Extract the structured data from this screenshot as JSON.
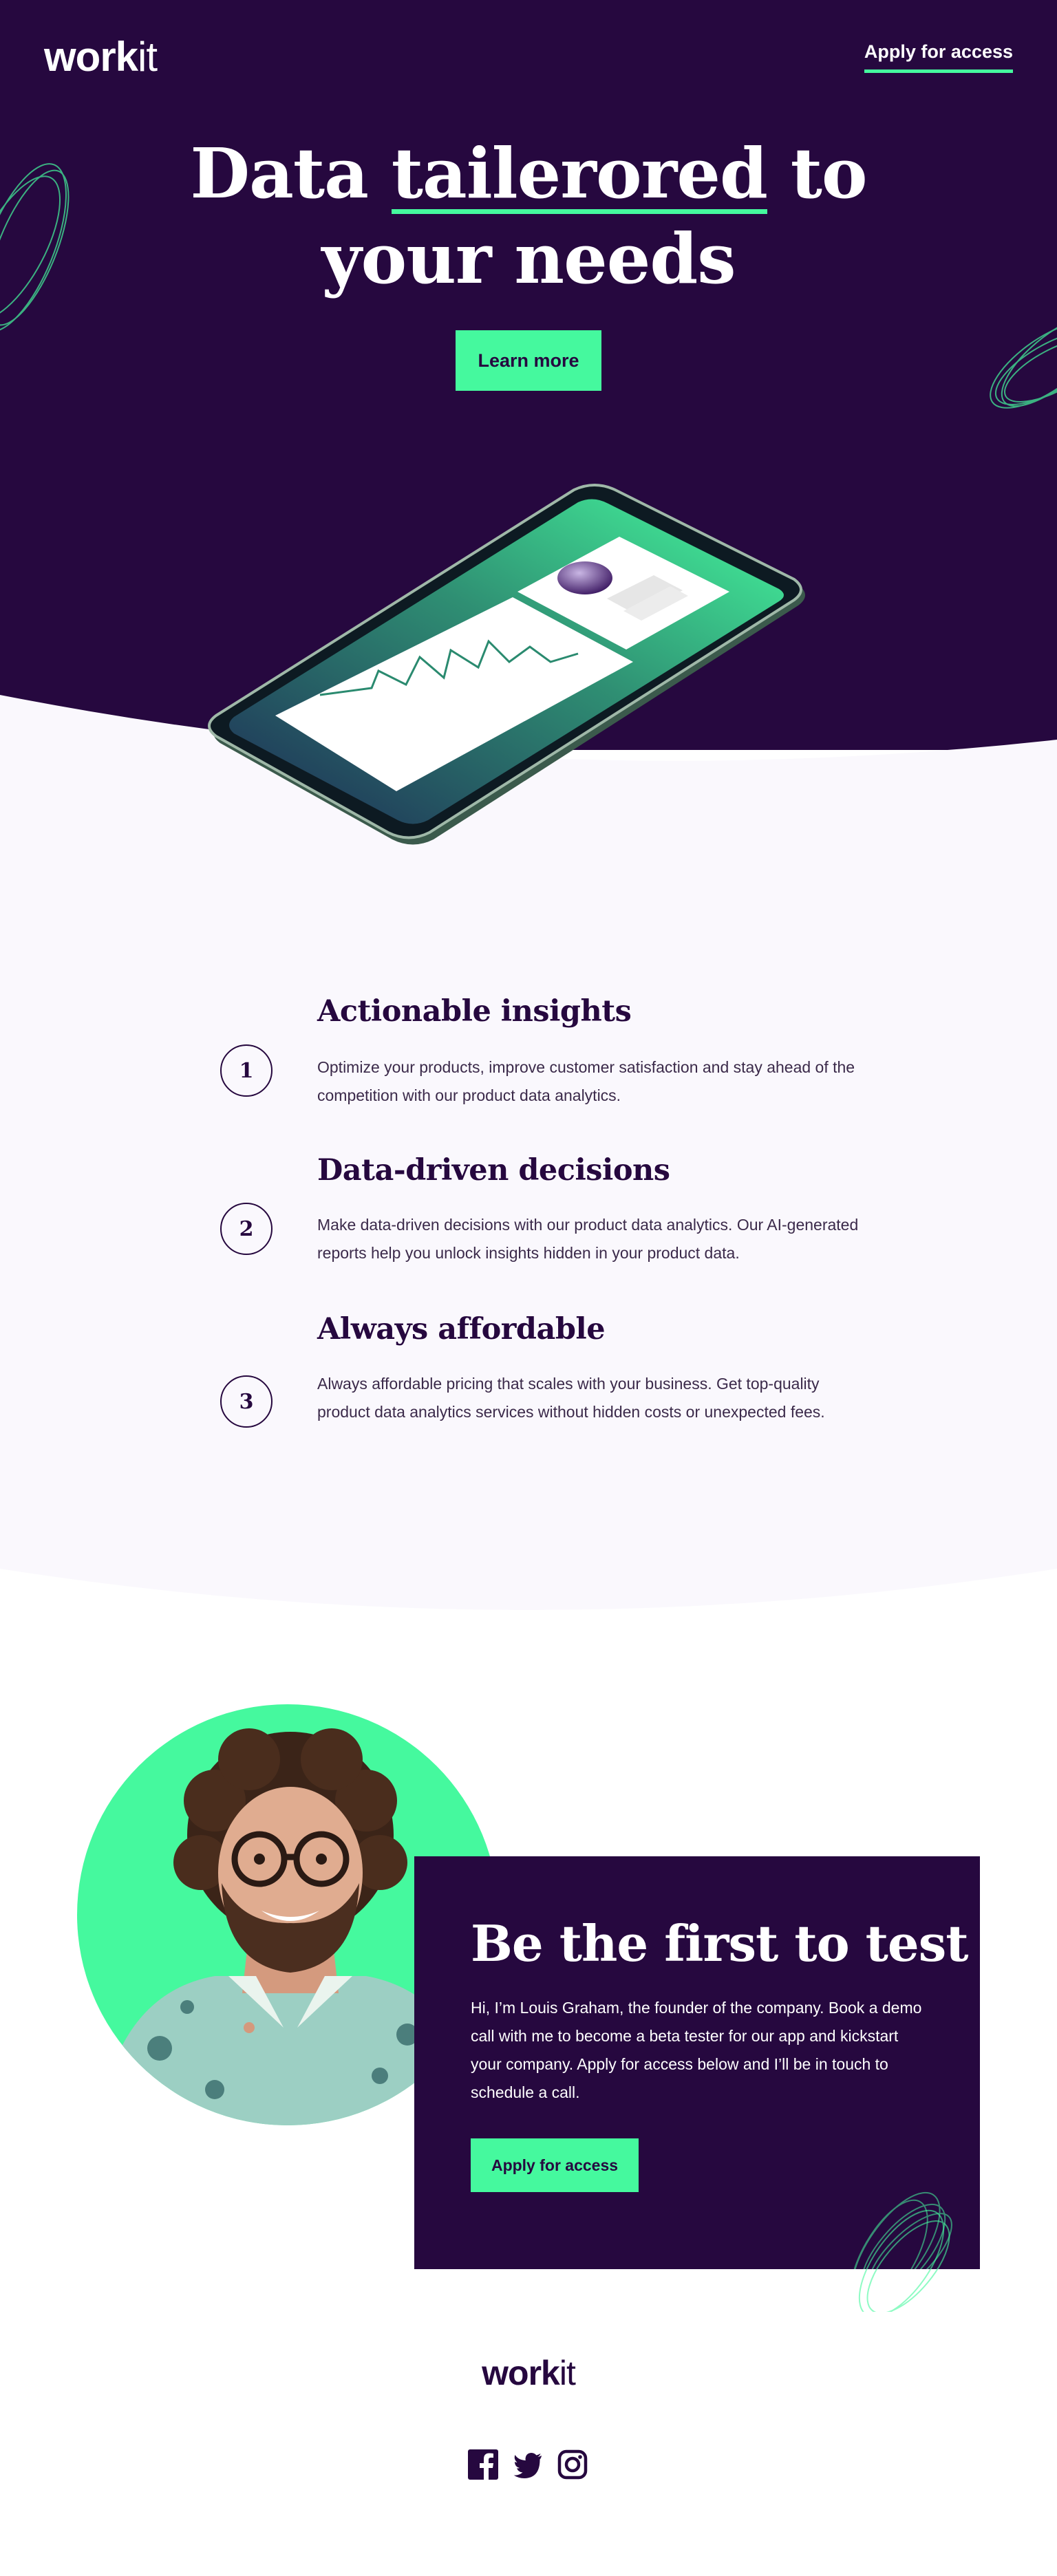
{
  "header": {
    "logo_bold": "work",
    "logo_light": "it",
    "apply_link": "Apply for access"
  },
  "hero": {
    "title_line1_pre": "Data ",
    "title_highlight": "tailerored",
    "title_line1_post": " to",
    "title_line2": "your needs",
    "cta": "Learn more"
  },
  "features": [
    {
      "number": "1",
      "title": "Actionable insights",
      "text": "Optimize your products, improve customer satisfaction and stay ahead of the competition with our product data analytics."
    },
    {
      "number": "2",
      "title": "Data-driven decisions",
      "text": "Make data-driven decisions with our product data analytics. Our AI-generated reports help you unlock insights hidden in your product data."
    },
    {
      "number": "3",
      "title": "Always affordable",
      "text": "Always affordable pricing that scales with your business. Get top-quality product data analytics services without hidden costs or unexpected fees."
    }
  ],
  "test": {
    "title": "Be the first to test",
    "text": "Hi, I’m Louis Graham, the founder of the company. Book a demo call with me to become a beta tester for our app and kickstart your company. Apply for access below and I’ll be in touch to schedule a call.",
    "cta": "Apply for access"
  },
  "footer": {
    "logo_bold": "work",
    "logo_light": "it",
    "social": [
      "facebook-icon",
      "twitter-icon",
      "instagram-icon"
    ]
  },
  "colors": {
    "dark_purple": "#26083f",
    "mint": "#45f99e",
    "light_bg": "#faf8fd"
  }
}
